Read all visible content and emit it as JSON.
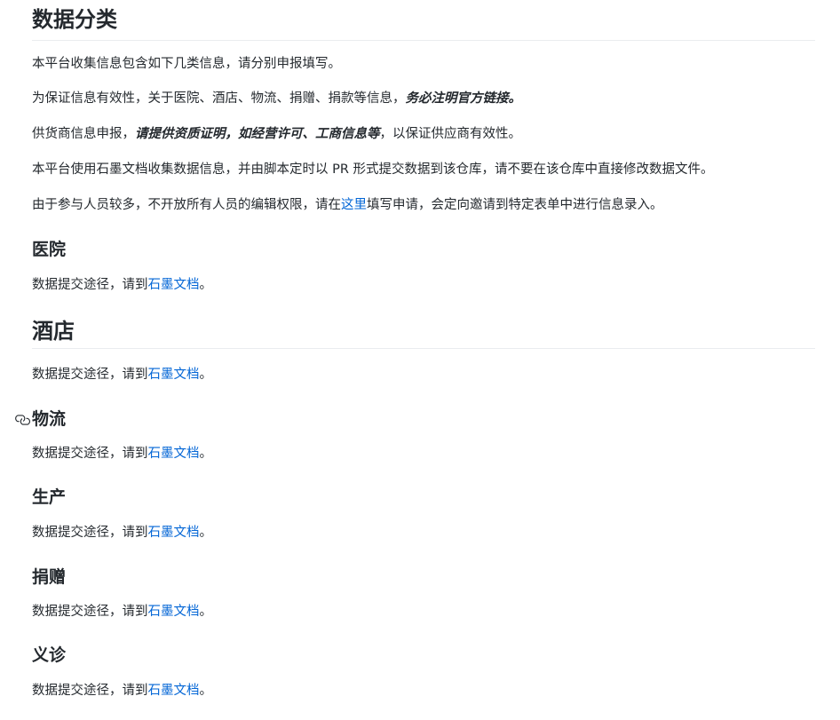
{
  "title": "数据分类",
  "intro": {
    "p1": "本平台收集信息包含如下几类信息，请分别申报填写。",
    "p2_prefix": "为保证信息有效性，关于医院、酒店、物流、捐赠、捐款等信息，",
    "p2_emphasis": "务必注明官方链接。",
    "p3_prefix": "供货商信息申报，",
    "p3_emphasis": "请提供资质证明，如经营许可、工商信息等",
    "p3_suffix": "，以保证供应商有效性。",
    "p4": "本平台使用石墨文档收集数据信息，并由脚本定时以 PR 形式提交数据到该仓库，请不要在该仓库中直接修改数据文件。",
    "p5_prefix": "由于参与人员较多，不开放所有人员的编辑权限，请在",
    "p5_link": "这里",
    "p5_suffix": "填写申请，会定向邀请到特定表单中进行信息录入。"
  },
  "sections": [
    {
      "heading": "医院",
      "text": "数据提交途径，请到",
      "link": "石墨文档",
      "end": "。"
    },
    {
      "heading": "酒店",
      "text": "数据提交途径，请到",
      "link": "石墨文档",
      "end": "。"
    },
    {
      "heading": "物流",
      "text": "数据提交途径，请到",
      "link": "石墨文档",
      "end": "。"
    },
    {
      "heading": "生产",
      "text": "数据提交途径，请到",
      "link": "石墨文档",
      "end": "。"
    },
    {
      "heading": "捐赠",
      "text": "数据提交途径，请到",
      "link": "石墨文档",
      "end": "。"
    },
    {
      "heading": "义诊",
      "text": "数据提交途径，请到",
      "link": "石墨文档",
      "end": "。"
    }
  ],
  "icons": {
    "anchor": "link-icon"
  },
  "colors": {
    "link": "#0366d6",
    "text": "#24292e",
    "rule": "#eaecef"
  }
}
